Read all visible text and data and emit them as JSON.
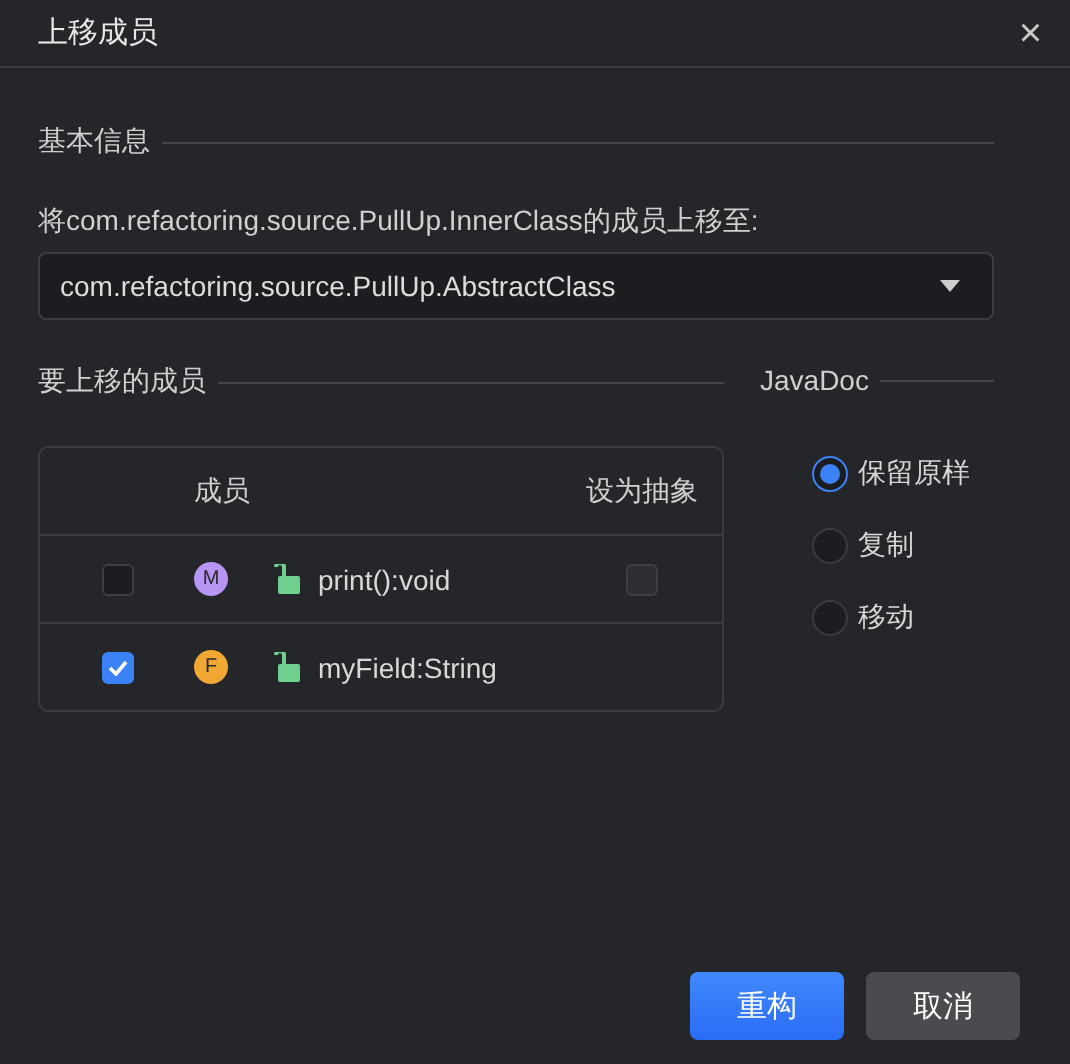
{
  "window": {
    "title": "上移成员",
    "close": "×"
  },
  "basic": {
    "heading": "基本信息",
    "label": "将com.refactoring.source.PullUp.InnerClass的成员上移至:",
    "target": "com.refactoring.source.PullUp.AbstractClass"
  },
  "members": {
    "heading": "要上移的成员",
    "columns": [
      "成员",
      "设为抽象"
    ],
    "rows": [
      {
        "checked": false,
        "kind": "method",
        "badge": "M",
        "name": "print():void",
        "abstract": false
      },
      {
        "checked": true,
        "kind": "field",
        "badge": "F",
        "name": "myField:String"
      }
    ]
  },
  "javadoc": {
    "heading": "JavaDoc",
    "options": [
      {
        "label": "保留原样",
        "selected": true
      },
      {
        "label": "复制",
        "selected": false
      },
      {
        "label": "移动",
        "selected": false
      }
    ]
  },
  "buttons": [
    {
      "label": "重构",
      "kind": "primary"
    },
    {
      "label": "取消",
      "kind": "secondary"
    }
  ]
}
